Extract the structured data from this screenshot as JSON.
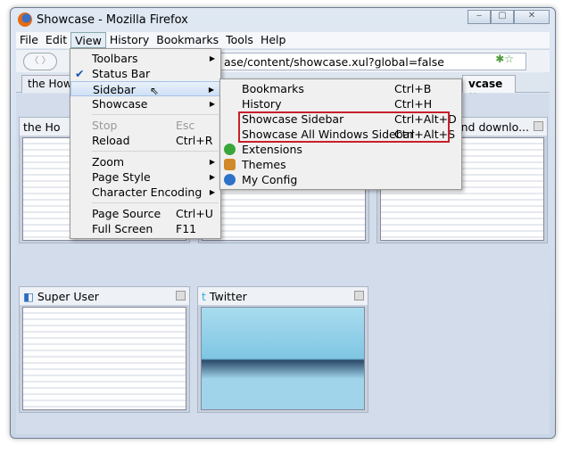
{
  "window": {
    "title": "Showcase - Mozilla Firefox",
    "controls": [
      "minimize",
      "maximize",
      "close"
    ]
  },
  "menubar": [
    "File",
    "Edit",
    "View",
    "History",
    "Bookmarks",
    "Tools",
    "Help"
  ],
  "nav": {
    "url": "ase/content/showcase.xul?global=false"
  },
  "tabs": [
    {
      "label": "the How"
    },
    {
      "label": "vcase"
    }
  ],
  "thumbnails": [
    {
      "title": "the Ho"
    },
    {
      "title": ""
    },
    {
      "title": "and downlo..."
    },
    {
      "title": "Super User"
    },
    {
      "title": "Twitter"
    }
  ],
  "view_menu": [
    {
      "label": "Toolbars",
      "submenu": true
    },
    {
      "label": "Status Bar",
      "checked": true
    },
    {
      "label": "Sidebar",
      "submenu": true,
      "highlighted": true
    },
    {
      "label": "Showcase",
      "submenu": true
    },
    {
      "label": "Stop",
      "shortcut": "Esc",
      "disabled": true
    },
    {
      "label": "Reload",
      "shortcut": "Ctrl+R"
    },
    {
      "label": "Zoom",
      "submenu": true
    },
    {
      "label": "Page Style",
      "submenu": true
    },
    {
      "label": "Character Encoding",
      "submenu": true
    },
    {
      "label": "Page Source",
      "shortcut": "Ctrl+U"
    },
    {
      "label": "Full Screen",
      "shortcut": "F11"
    }
  ],
  "sidebar_menu": [
    {
      "label": "Bookmarks",
      "shortcut": "Ctrl+B"
    },
    {
      "label": "History",
      "shortcut": "Ctrl+H"
    },
    {
      "label": "Showcase Sidebar",
      "shortcut": "Ctrl+Alt+D"
    },
    {
      "label": "Showcase All Windows Sidebar",
      "shortcut": "Ctrl+Alt+S"
    },
    {
      "label": "Extensions"
    },
    {
      "label": "Themes"
    },
    {
      "label": "My Config"
    }
  ],
  "colors": {
    "highlight_box": "#c8202a"
  }
}
